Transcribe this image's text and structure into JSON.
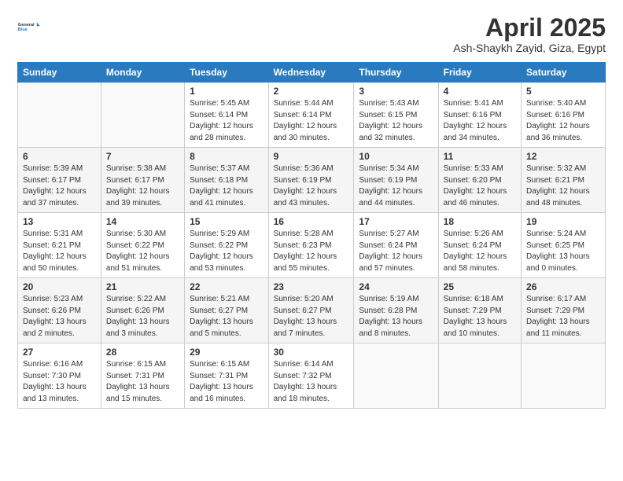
{
  "logo": {
    "line1": "General",
    "line2": "Blue"
  },
  "title": "April 2025",
  "subtitle": "Ash-Shaykh Zayid, Giza, Egypt",
  "days_header": [
    "Sunday",
    "Monday",
    "Tuesday",
    "Wednesday",
    "Thursday",
    "Friday",
    "Saturday"
  ],
  "weeks": [
    [
      {
        "num": "",
        "info": ""
      },
      {
        "num": "",
        "info": ""
      },
      {
        "num": "1",
        "info": "Sunrise: 5:45 AM\nSunset: 6:14 PM\nDaylight: 12 hours\nand 28 minutes."
      },
      {
        "num": "2",
        "info": "Sunrise: 5:44 AM\nSunset: 6:14 PM\nDaylight: 12 hours\nand 30 minutes."
      },
      {
        "num": "3",
        "info": "Sunrise: 5:43 AM\nSunset: 6:15 PM\nDaylight: 12 hours\nand 32 minutes."
      },
      {
        "num": "4",
        "info": "Sunrise: 5:41 AM\nSunset: 6:16 PM\nDaylight: 12 hours\nand 34 minutes."
      },
      {
        "num": "5",
        "info": "Sunrise: 5:40 AM\nSunset: 6:16 PM\nDaylight: 12 hours\nand 36 minutes."
      }
    ],
    [
      {
        "num": "6",
        "info": "Sunrise: 5:39 AM\nSunset: 6:17 PM\nDaylight: 12 hours\nand 37 minutes."
      },
      {
        "num": "7",
        "info": "Sunrise: 5:38 AM\nSunset: 6:17 PM\nDaylight: 12 hours\nand 39 minutes."
      },
      {
        "num": "8",
        "info": "Sunrise: 5:37 AM\nSunset: 6:18 PM\nDaylight: 12 hours\nand 41 minutes."
      },
      {
        "num": "9",
        "info": "Sunrise: 5:36 AM\nSunset: 6:19 PM\nDaylight: 12 hours\nand 43 minutes."
      },
      {
        "num": "10",
        "info": "Sunrise: 5:34 AM\nSunset: 6:19 PM\nDaylight: 12 hours\nand 44 minutes."
      },
      {
        "num": "11",
        "info": "Sunrise: 5:33 AM\nSunset: 6:20 PM\nDaylight: 12 hours\nand 46 minutes."
      },
      {
        "num": "12",
        "info": "Sunrise: 5:32 AM\nSunset: 6:21 PM\nDaylight: 12 hours\nand 48 minutes."
      }
    ],
    [
      {
        "num": "13",
        "info": "Sunrise: 5:31 AM\nSunset: 6:21 PM\nDaylight: 12 hours\nand 50 minutes."
      },
      {
        "num": "14",
        "info": "Sunrise: 5:30 AM\nSunset: 6:22 PM\nDaylight: 12 hours\nand 51 minutes."
      },
      {
        "num": "15",
        "info": "Sunrise: 5:29 AM\nSunset: 6:22 PM\nDaylight: 12 hours\nand 53 minutes."
      },
      {
        "num": "16",
        "info": "Sunrise: 5:28 AM\nSunset: 6:23 PM\nDaylight: 12 hours\nand 55 minutes."
      },
      {
        "num": "17",
        "info": "Sunrise: 5:27 AM\nSunset: 6:24 PM\nDaylight: 12 hours\nand 57 minutes."
      },
      {
        "num": "18",
        "info": "Sunrise: 5:26 AM\nSunset: 6:24 PM\nDaylight: 12 hours\nand 58 minutes."
      },
      {
        "num": "19",
        "info": "Sunrise: 5:24 AM\nSunset: 6:25 PM\nDaylight: 13 hours\nand 0 minutes."
      }
    ],
    [
      {
        "num": "20",
        "info": "Sunrise: 5:23 AM\nSunset: 6:26 PM\nDaylight: 13 hours\nand 2 minutes."
      },
      {
        "num": "21",
        "info": "Sunrise: 5:22 AM\nSunset: 6:26 PM\nDaylight: 13 hours\nand 3 minutes."
      },
      {
        "num": "22",
        "info": "Sunrise: 5:21 AM\nSunset: 6:27 PM\nDaylight: 13 hours\nand 5 minutes."
      },
      {
        "num": "23",
        "info": "Sunrise: 5:20 AM\nSunset: 6:27 PM\nDaylight: 13 hours\nand 7 minutes."
      },
      {
        "num": "24",
        "info": "Sunrise: 5:19 AM\nSunset: 6:28 PM\nDaylight: 13 hours\nand 8 minutes."
      },
      {
        "num": "25",
        "info": "Sunrise: 6:18 AM\nSunset: 7:29 PM\nDaylight: 13 hours\nand 10 minutes."
      },
      {
        "num": "26",
        "info": "Sunrise: 6:17 AM\nSunset: 7:29 PM\nDaylight: 13 hours\nand 11 minutes."
      }
    ],
    [
      {
        "num": "27",
        "info": "Sunrise: 6:16 AM\nSunset: 7:30 PM\nDaylight: 13 hours\nand 13 minutes."
      },
      {
        "num": "28",
        "info": "Sunrise: 6:15 AM\nSunset: 7:31 PM\nDaylight: 13 hours\nand 15 minutes."
      },
      {
        "num": "29",
        "info": "Sunrise: 6:15 AM\nSunset: 7:31 PM\nDaylight: 13 hours\nand 16 minutes."
      },
      {
        "num": "30",
        "info": "Sunrise: 6:14 AM\nSunset: 7:32 PM\nDaylight: 13 hours\nand 18 minutes."
      },
      {
        "num": "",
        "info": ""
      },
      {
        "num": "",
        "info": ""
      },
      {
        "num": "",
        "info": ""
      }
    ]
  ]
}
